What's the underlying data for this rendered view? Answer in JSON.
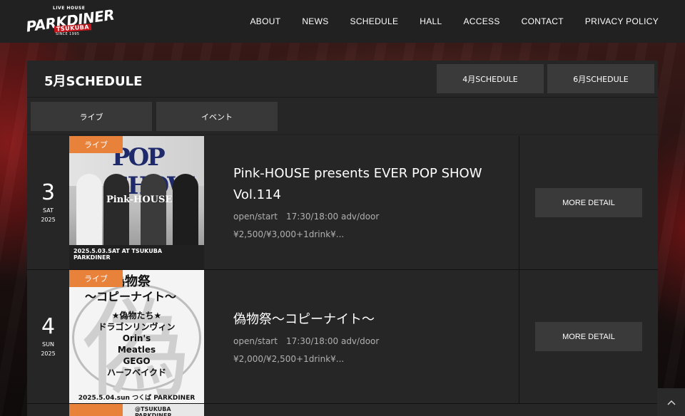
{
  "logo": {
    "top": "LIVE HOUSE",
    "main": "PARKDINER",
    "sub": "TSUKUBA",
    "since": "SINCE 1995"
  },
  "nav": [
    "ABOUT",
    "NEWS",
    "SCHEDULE",
    "HALL",
    "ACCESS",
    "CONTACT",
    "PRIVACY POLICY"
  ],
  "schedule": {
    "title": "5月SCHEDULE",
    "prev_label": "4月SCHEDULE",
    "next_label": "6月SCHEDULE",
    "filters": [
      "ライブ",
      "イベント"
    ]
  },
  "events": [
    {
      "day": "3",
      "weekday": "SAT",
      "year": "2025",
      "tag": "ライブ",
      "title": "Pink-HOUSE presents EVER POP SHOW Vol.114",
      "time": "open/start　17:30/18:00 adv/door",
      "price": "¥2,500/¥3,000+1drink¥...",
      "detail_label": "MORE DETAIL",
      "flyer": {
        "title": "POP SHOW",
        "band": "Pink-HOUSE",
        "bottom": "2025.5.03.SAT AT TSUKUBA PARKDINER"
      }
    },
    {
      "day": "4",
      "weekday": "SUN",
      "year": "2025",
      "tag": "ライブ",
      "title": "偽物祭〜コピーナイト〜",
      "time": "open/start　17:30/18:00 adv/door",
      "price": "¥2,000/¥2,500+1drink¥...",
      "detail_label": "MORE DETAIL",
      "flyer": {
        "big": "偽",
        "h1": "偽物祭",
        "h2": "〜コピーナイト〜",
        "lineup": [
          "★偽物たち★",
          "ドラゴンリンヴィン",
          "Orin's",
          "Meatles",
          "GEGO",
          "ハーフベイクド"
        ],
        "foot": "2025.5.04.sun つくば PARKDINER"
      }
    }
  ],
  "peek_row": {
    "text": "@TSUKUBA PARKDINER"
  },
  "to_top_icon": "chevron-up-icon"
}
